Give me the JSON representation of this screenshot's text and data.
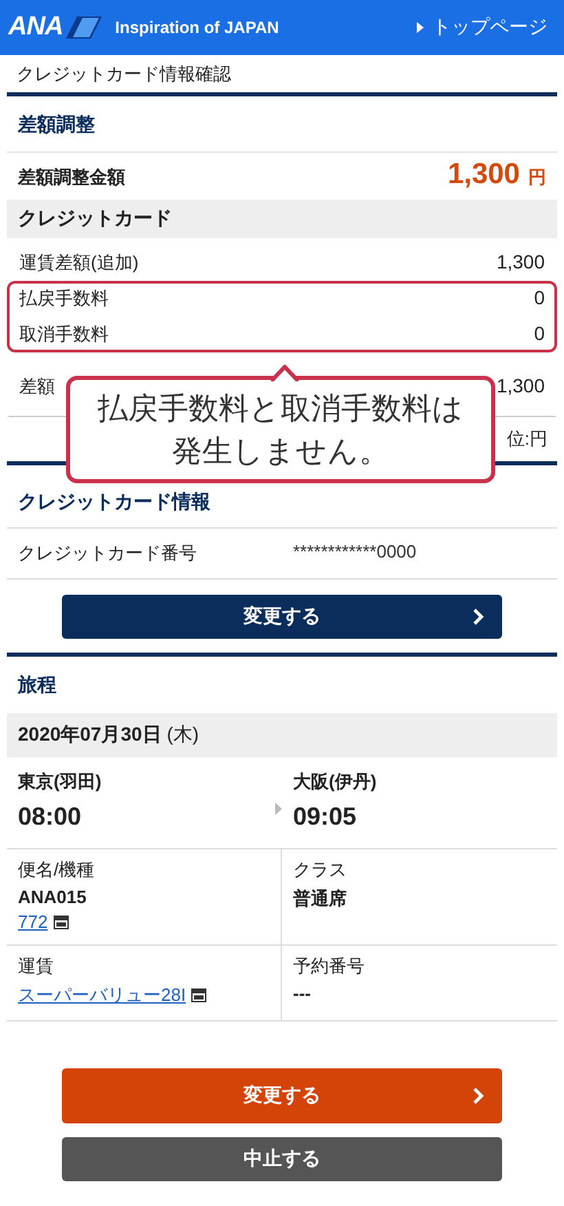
{
  "header": {
    "logo": "ANA",
    "tagline": "Inspiration of JAPAN",
    "top_link": "トップページ"
  },
  "breadcrumb": "クレジットカード情報確認",
  "adjustment": {
    "title": "差額調整",
    "total_label": "差額調整金額",
    "total_value": "1,300",
    "total_unit": "円",
    "card_heading": "クレジットカード",
    "rows": [
      {
        "label": "運賃差額(追加)",
        "value": "1,300",
        "highlighted": false
      },
      {
        "label": "払戻手数料",
        "value": "0",
        "highlighted": true
      },
      {
        "label": "取消手数料",
        "value": "0",
        "highlighted": true
      },
      {
        "label": "差額",
        "value": "1,300",
        "highlighted": false
      }
    ],
    "unit_note": "位:円"
  },
  "callout": {
    "text": "払戻手数料と取消手数料は発生しません。"
  },
  "card_info": {
    "title": "クレジットカード情報",
    "number_label": "クレジットカード番号",
    "number_value": "************0000",
    "change_button": "変更する"
  },
  "itinerary": {
    "title": "旅程",
    "date": "2020年07月30日",
    "weekday": "(木)",
    "departure": {
      "airport": "東京(羽田)",
      "time": "08:00"
    },
    "arrival": {
      "airport": "大阪(伊丹)",
      "time": "09:05"
    },
    "details": [
      {
        "label": "便名/機種",
        "value": "ANA015",
        "link": "772"
      },
      {
        "label": "クラス",
        "value": "普通席"
      },
      {
        "label": "運賃",
        "link": "スーパーバリュー28I"
      },
      {
        "label": "予約番号",
        "value": "---"
      }
    ]
  },
  "actions": [
    {
      "label": "変更する",
      "kind": "primary"
    },
    {
      "label": "中止する",
      "kind": "secondary"
    }
  ]
}
